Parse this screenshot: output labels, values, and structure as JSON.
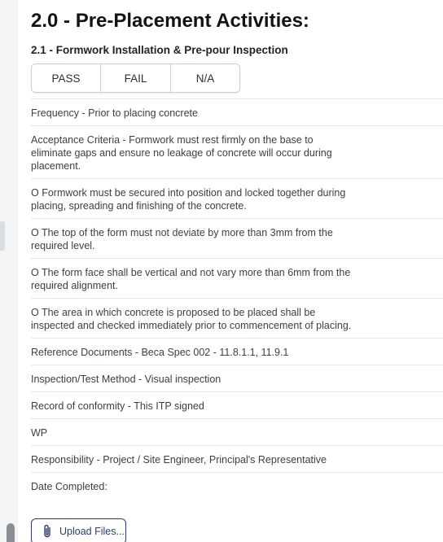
{
  "section": {
    "title": "2.0 - Pre-Placement Activities:",
    "subtitle": "2.1 - Formwork Installation & Pre-pour Inspection"
  },
  "result_options": {
    "pass": "PASS",
    "fail": "FAIL",
    "na": "N/A"
  },
  "rows": [
    "Frequency - Prior to placing concrete",
    "Acceptance Criteria - Formwork must rest firmly on the base to eliminate gaps and ensure no leakage of concrete will occur during placement.",
    "O Formwork must be secured into position and locked together during placing, spreading and finishing of the concrete.",
    "O The top of the form must not deviate by more than 3mm from the required level.",
    "O The form face shall be vertical and not vary more than 6mm from the required alignment.",
    "O The area in which concrete is proposed to be placed shall be inspected and checked immediately prior to commencement of placing.",
    "Reference Documents - Beca Spec 002 - 11.8.1.1, 11.9.1",
    "Inspection/Test Method - Visual inspection",
    "Record of conformity - This ITP signed",
    "WP",
    "Responsibility - Project / Site Engineer, Principal's Representative",
    "Date Completed:"
  ],
  "upload": {
    "label": "Upload Files...",
    "icon": "paperclip-icon"
  },
  "colors": {
    "accent": "#2c3e66",
    "divider": "#e3e5e8",
    "button_border": "#c9ccd1"
  }
}
